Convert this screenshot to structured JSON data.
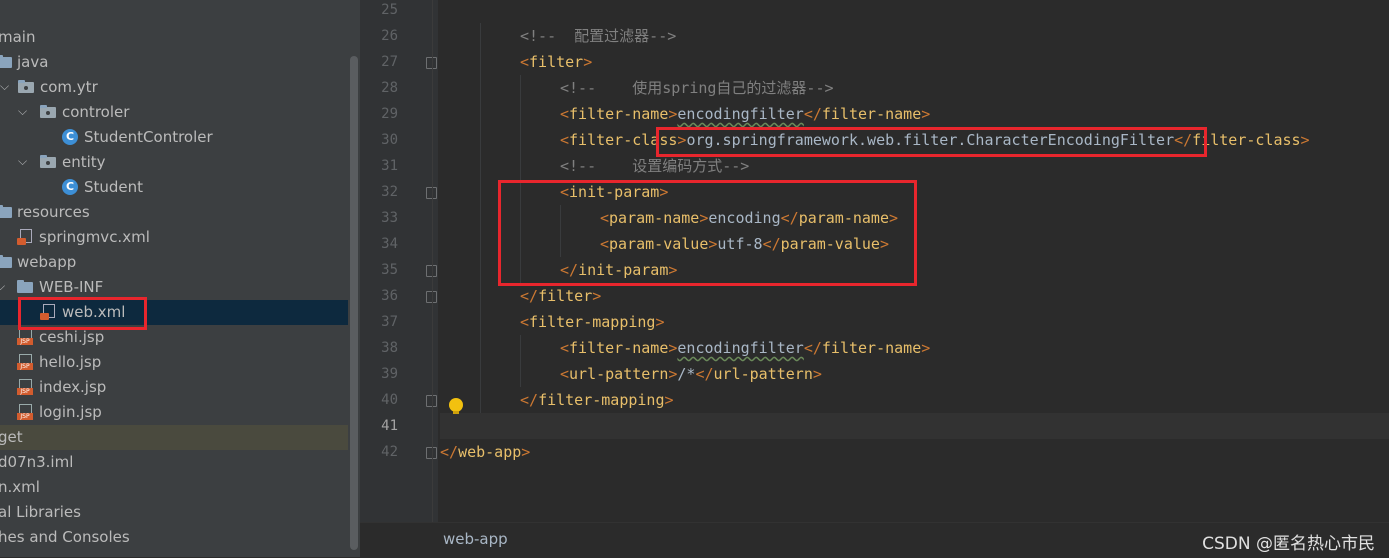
{
  "tree": {
    "items": [
      {
        "label": "main",
        "kind": "none"
      },
      {
        "label": "java",
        "kind": "folder"
      },
      {
        "label": "com.ytr",
        "kind": "pkg"
      },
      {
        "label": "controler",
        "kind": "pkg"
      },
      {
        "label": "StudentControler",
        "kind": "class"
      },
      {
        "label": "entity",
        "kind": "pkg"
      },
      {
        "label": "Student",
        "kind": "class"
      },
      {
        "label": "resources",
        "kind": "folder"
      },
      {
        "label": "springmvc.xml",
        "kind": "xml"
      },
      {
        "label": "webapp",
        "kind": "folder"
      },
      {
        "label": "WEB-INF",
        "kind": "folder"
      },
      {
        "label": "web.xml",
        "kind": "xml"
      },
      {
        "label": "ceshi.jsp",
        "kind": "jsp"
      },
      {
        "label": "hello.jsp",
        "kind": "jsp"
      },
      {
        "label": "index.jsp",
        "kind": "jsp"
      },
      {
        "label": "login.jsp",
        "kind": "jsp"
      },
      {
        "label": "get",
        "kind": "none"
      },
      {
        "label": "d07n3.iml",
        "kind": "none"
      },
      {
        "label": "n.xml",
        "kind": "none"
      },
      {
        "label": "al Libraries",
        "kind": "none"
      },
      {
        "label": "hes and Consoles",
        "kind": "none"
      }
    ]
  },
  "icons": {
    "class_letter": "C",
    "jsp_badge": "JSP"
  },
  "editor": {
    "line_numbers": [
      "25",
      "26",
      "27",
      "28",
      "29",
      "30",
      "31",
      "32",
      "33",
      "34",
      "35",
      "36",
      "37",
      "38",
      "39",
      "40",
      "41",
      "42"
    ],
    "lines": [
      [],
      [
        {
          "c": "cm",
          "t": "<!--  配置过滤器-->"
        }
      ],
      [
        {
          "c": "b",
          "t": "<"
        },
        {
          "c": "t",
          "t": "filter"
        },
        {
          "c": "b",
          "t": ">"
        }
      ],
      [
        {
          "c": "cm",
          "t": "<!--    使用spring自己的过滤器-->"
        }
      ],
      [
        {
          "c": "b",
          "t": "<"
        },
        {
          "c": "t",
          "t": "filter-name"
        },
        {
          "c": "b",
          "t": ">"
        },
        {
          "c": "tx u",
          "t": "encodingfilter"
        },
        {
          "c": "b",
          "t": "</"
        },
        {
          "c": "t",
          "t": "filter-name"
        },
        {
          "c": "b",
          "t": ">"
        }
      ],
      [
        {
          "c": "b",
          "t": "<"
        },
        {
          "c": "t",
          "t": "filter-class"
        },
        {
          "c": "b",
          "t": ">"
        },
        {
          "c": "tx",
          "t": "org.springframework.web.filter.CharacterEncodingFilter"
        },
        {
          "c": "b",
          "t": "</"
        },
        {
          "c": "t",
          "t": "filter-class"
        },
        {
          "c": "b",
          "t": ">"
        }
      ],
      [
        {
          "c": "cm",
          "t": "<!--    设置编码方式-->"
        }
      ],
      [
        {
          "c": "b",
          "t": "<"
        },
        {
          "c": "t",
          "t": "init-param"
        },
        {
          "c": "b",
          "t": ">"
        }
      ],
      [
        {
          "c": "b",
          "t": "<"
        },
        {
          "c": "t",
          "t": "param-name"
        },
        {
          "c": "b",
          "t": ">"
        },
        {
          "c": "tx",
          "t": "encoding"
        },
        {
          "c": "b",
          "t": "</"
        },
        {
          "c": "t",
          "t": "param-name"
        },
        {
          "c": "b",
          "t": ">"
        }
      ],
      [
        {
          "c": "b",
          "t": "<"
        },
        {
          "c": "t",
          "t": "param-value"
        },
        {
          "c": "b",
          "t": ">"
        },
        {
          "c": "tx",
          "t": "utf-8"
        },
        {
          "c": "b",
          "t": "</"
        },
        {
          "c": "t",
          "t": "param-value"
        },
        {
          "c": "b",
          "t": ">"
        }
      ],
      [
        {
          "c": "b",
          "t": "</"
        },
        {
          "c": "t",
          "t": "init-param"
        },
        {
          "c": "b",
          "t": ">"
        }
      ],
      [
        {
          "c": "b",
          "t": "</"
        },
        {
          "c": "t",
          "t": "filter"
        },
        {
          "c": "b",
          "t": ">"
        }
      ],
      [
        {
          "c": "b",
          "t": "<"
        },
        {
          "c": "t",
          "t": "filter-mapping"
        },
        {
          "c": "b",
          "t": ">"
        }
      ],
      [
        {
          "c": "b",
          "t": "<"
        },
        {
          "c": "t",
          "t": "filter-name"
        },
        {
          "c": "b",
          "t": ">"
        },
        {
          "c": "tx u",
          "t": "encodingfilter"
        },
        {
          "c": "b",
          "t": "</"
        },
        {
          "c": "t",
          "t": "filter-name"
        },
        {
          "c": "b",
          "t": ">"
        }
      ],
      [
        {
          "c": "b",
          "t": "<"
        },
        {
          "c": "t",
          "t": "url-pattern"
        },
        {
          "c": "b",
          "t": ">"
        },
        {
          "c": "tx",
          "t": "/*"
        },
        {
          "c": "b",
          "t": "</"
        },
        {
          "c": "t",
          "t": "url-pattern"
        },
        {
          "c": "b",
          "t": ">"
        }
      ],
      [
        {
          "c": "b",
          "t": "</"
        },
        {
          "c": "t",
          "t": "filter-mapping"
        },
        {
          "c": "b",
          "t": ">"
        }
      ],
      [],
      [
        {
          "c": "b",
          "t": "</"
        },
        {
          "c": "t",
          "t": "web-app"
        },
        {
          "c": "b",
          "t": ">"
        }
      ]
    ]
  },
  "statusbar": {
    "breadcrumb": "web-app"
  },
  "watermark": "CSDN @匿名热心市民",
  "colors": {
    "tag": "#e8bf6a",
    "bracket": "#cc7832",
    "comment": "#808080",
    "text": "#a9b7c6",
    "highlight_box": "#e8262d",
    "selection": "#0d293e"
  }
}
